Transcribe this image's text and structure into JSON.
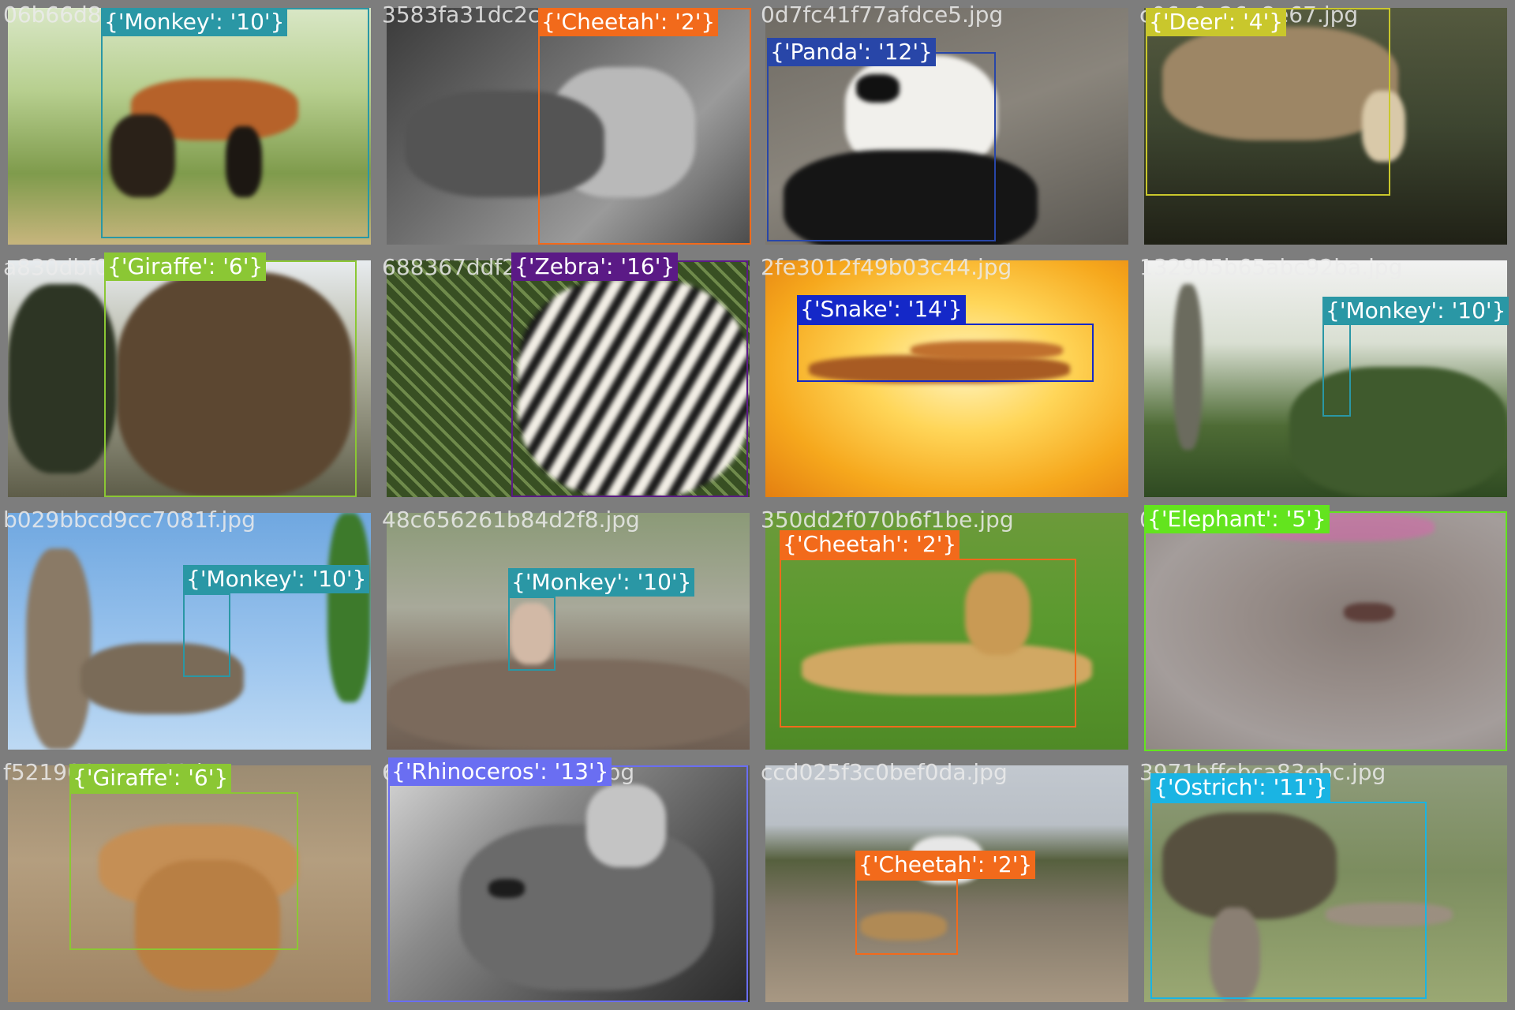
{
  "tiles": [
    {
      "filename": "06b66d8",
      "det": {
        "label": "{'Monkey': '10'}",
        "color": "#2a97a5"
      },
      "photo": {
        "bg": "linear-gradient(180deg,#d9e7c6 0%,#b7cf8f 35%,#7f9b4c 70%,#c7b57d 100%)",
        "blobs": [
          {
            "c": "#b6622a",
            "l": "34%",
            "t": "30%",
            "w": "46%",
            "h": "26%"
          },
          {
            "c": "#2a2118",
            "l": "28%",
            "t": "45%",
            "w": "18%",
            "h": "35%"
          },
          {
            "c": "#1c1712",
            "l": "60%",
            "t": "50%",
            "w": "10%",
            "h": "30%"
          }
        ]
      }
    },
    {
      "filename": "3583fa31dc2c",
      "det": {
        "label": "{'Cheetah': '2'}",
        "color": "#f26a1b"
      },
      "photo": {
        "bg": "linear-gradient(135deg,#3a3a3a 0%,#6d6d6d 40%,#9a9a9a 70%,#4c4c4c 100%)",
        "blobs": [
          {
            "c": "#b9b9b9",
            "l": "45%",
            "t": "25%",
            "w": "40%",
            "h": "55%"
          },
          {
            "c": "#545454",
            "l": "5%",
            "t": "35%",
            "w": "55%",
            "h": "45%"
          }
        ]
      }
    },
    {
      "filename": "0d7fc41f77afdce5.jpg",
      "det": {
        "label": "{'Panda': '12'}",
        "color": "#2846a8"
      },
      "photo": {
        "bg": "linear-gradient(160deg,#6e6a63 0%,#8a857c 50%,#5b5852 100%)",
        "blobs": [
          {
            "c": "#f1f0ec",
            "l": "22%",
            "t": "20%",
            "w": "42%",
            "h": "50%"
          },
          {
            "c": "#151515",
            "l": "5%",
            "t": "60%",
            "w": "70%",
            "h": "45%"
          },
          {
            "c": "#111111",
            "l": "25%",
            "t": "28%",
            "w": "12%",
            "h": "12%"
          }
        ]
      }
    },
    {
      "filename": "c06e9c26a8e67.jpg",
      "det": {
        "label": "{'Deer': '4'}",
        "color": "#c9c72c"
      },
      "photo": {
        "bg": "linear-gradient(180deg,#555a3f 0%,#3d4530 50%,#202116 100%)",
        "blobs": [
          {
            "c": "#9d8665",
            "l": "5%",
            "t": "8%",
            "w": "65%",
            "h": "48%"
          },
          {
            "c": "#d9c9a9",
            "l": "60%",
            "t": "35%",
            "w": "12%",
            "h": "30%"
          }
        ]
      }
    },
    {
      "filename": "a830dbf04385b821.jpg",
      "det": {
        "label": "{'Giraffe': '6'}",
        "color": "#8bc734"
      },
      "photo": {
        "bg": "linear-gradient(180deg,#e8ecef 0%,#b5b6a4 40%,#5e5d49 100%)",
        "blobs": [
          {
            "c": "#5c4731",
            "l": "30%",
            "t": "5%",
            "w": "65%",
            "h": "95%"
          },
          {
            "c": "#2d3524",
            "l": "0%",
            "t": "10%",
            "w": "30%",
            "h": "80%"
          }
        ]
      }
    },
    {
      "filename": "688367ddf28403d.jpg",
      "det": {
        "label": "{'Zebra': '16'}",
        "color": "#5b1a86"
      },
      "photo": {
        "bg": "repeating-linear-gradient(45deg,#384f23 0px,#384f23 10px,#6f8a4b 10px,#6f8a4b 14px)",
        "blobs": [
          {
            "c": "repeating-linear-gradient(120deg,#f3efe6 0px,#f3efe6 14px,#1a1a1a 14px,#1a1a1a 26px)",
            "l": "36%",
            "t": "8%",
            "w": "64%",
            "h": "92%"
          }
        ]
      }
    },
    {
      "filename": "2fe3012f49b03c44.jpg",
      "det": {
        "label": "{'Snake': '14'}",
        "color": "#1428c8"
      },
      "photo": {
        "bg": "radial-gradient(ellipse at 55% 45%,#fff4c0 0%,#ffd659 35%,#f6a81d 70%,#e47f10 100%)",
        "blobs": [
          {
            "c": "#a85b23",
            "l": "12%",
            "t": "40%",
            "w": "72%",
            "h": "12%"
          },
          {
            "c": "#c0702e",
            "l": "40%",
            "t": "34%",
            "w": "42%",
            "h": "8%"
          }
        ]
      }
    },
    {
      "filename": "132905b65abc92ba.jpg",
      "det": {
        "label": "{'Monkey': '10'}",
        "color": "#2a97a5"
      },
      "photo": {
        "bg": "linear-gradient(180deg,#f2f2f2 0%,#d9dfd2 35%,#4e6b35 70%,#2f4a22 100%)",
        "blobs": [
          {
            "c": "#6b6b5e",
            "l": "8%",
            "t": "10%",
            "w": "8%",
            "h": "70%"
          },
          {
            "c": "#3f5a2d",
            "l": "40%",
            "t": "45%",
            "w": "60%",
            "h": "55%"
          }
        ]
      }
    },
    {
      "filename": "b029bbcd9cc7081f.jpg",
      "det": {
        "label": "{'Monkey': '10'}",
        "color": "#2a97a5"
      },
      "photo": {
        "bg": "linear-gradient(180deg,#6fa7e0 0%,#9cc5ee 60%,#bdd9f3 100%)",
        "blobs": [
          {
            "c": "#8a7a66",
            "l": "5%",
            "t": "15%",
            "w": "18%",
            "h": "85%"
          },
          {
            "c": "#7a6b58",
            "l": "20%",
            "t": "55%",
            "w": "45%",
            "h": "30%"
          },
          {
            "c": "#3d7a2b",
            "l": "88%",
            "t": "0%",
            "w": "12%",
            "h": "80%"
          }
        ]
      }
    },
    {
      "filename": "48c656261b84d2f8.jpg",
      "det": {
        "label": "{'Monkey': '10'}",
        "color": "#2a97a5"
      },
      "photo": {
        "bg": "linear-gradient(180deg,#8b9a77 0%,#a8a99a 40%,#8c8173 62%,#6e5e52 100%)",
        "blobs": [
          {
            "c": "#7b6a5c",
            "l": "0%",
            "t": "62%",
            "w": "100%",
            "h": "38%"
          },
          {
            "c": "#d2b9a6",
            "l": "34%",
            "t": "38%",
            "w": "12%",
            "h": "26%"
          }
        ]
      }
    },
    {
      "filename": "350dd2f070b6f1be.jpg",
      "det": {
        "label": "{'Cheetah': '2'}",
        "color": "#f26a1b"
      },
      "photo": {
        "bg": "linear-gradient(180deg,#6c9a3a 0%,#5b9a2f 45%,#4f8a26 100%)",
        "blobs": [
          {
            "c": "#d1a863",
            "l": "10%",
            "t": "55%",
            "w": "80%",
            "h": "22%"
          },
          {
            "c": "#c99a54",
            "l": "55%",
            "t": "25%",
            "w": "18%",
            "h": "35%"
          }
        ]
      }
    },
    {
      "filename": "0d1db...1f61.jpg",
      "det": {
        "label": "{'Elephant': '5'}",
        "color": "#63e41e"
      },
      "photo": {
        "bg": "radial-gradient(ellipse at 60% 45%,#867b76 0%,#988e8a 40%,#a49d9b 70%,#8f8783 100%)",
        "blobs": [
          {
            "c": "#5d3f3a",
            "l": "55%",
            "t": "38%",
            "w": "14%",
            "h": "8%"
          },
          {
            "c": "rgba(230,90,180,0.45)",
            "l": "30%",
            "t": "0%",
            "w": "50%",
            "h": "12%"
          }
        ]
      }
    },
    {
      "filename": "f521906c4c4a82.jpg",
      "det": {
        "label": "{'Giraffe': '6'}",
        "color": "#8bc734"
      },
      "photo": {
        "bg": "linear-gradient(180deg,#9c8c72 0%,#b49e7f 40%,#a08563 100%)",
        "blobs": [
          {
            "c": "#c58f55",
            "l": "25%",
            "t": "25%",
            "w": "55%",
            "h": "35%"
          },
          {
            "c": "#b87f44",
            "l": "35%",
            "t": "40%",
            "w": "40%",
            "h": "55%"
          }
        ]
      }
    },
    {
      "filename": "683f62f92398ae57.jpg",
      "det": {
        "label": "{'Rhinoceros': '13'}",
        "color": "#6a6ef2"
      },
      "photo": {
        "bg": "linear-gradient(135deg,#d6d6d6 0%,#8a8a8a 35%,#505050 70%,#2a2a2a 100%)",
        "blobs": [
          {
            "c": "#6a6a6a",
            "l": "20%",
            "t": "25%",
            "w": "70%",
            "h": "70%"
          },
          {
            "c": "#c4c4c4",
            "l": "55%",
            "t": "8%",
            "w": "22%",
            "h": "35%"
          },
          {
            "c": "#1c1c1c",
            "l": "28%",
            "t": "48%",
            "w": "10%",
            "h": "8%"
          }
        ]
      }
    },
    {
      "filename": "ccd025f3c0bef0da.jpg",
      "det": {
        "label": "{'Cheetah': '2'}",
        "color": "#f26a1b"
      },
      "photo": {
        "bg": "linear-gradient(180deg,#c2c8cf 0%,#b9bfc6 25%,#56603e 40%,#7f7667 60%,#a89883 100%)",
        "blobs": [
          {
            "c": "#e7e7e7",
            "l": "40%",
            "t": "30%",
            "w": "20%",
            "h": "20%"
          },
          {
            "c": "#b08a55",
            "l": "26%",
            "t": "62%",
            "w": "24%",
            "h": "12%"
          }
        ]
      }
    },
    {
      "filename": "3971bffcbca83ebc.jpg",
      "det": {
        "label": "{'Ostrich': '11'}",
        "color": "#1ab4e3"
      },
      "photo": {
        "bg": "linear-gradient(180deg,#8e9b7a 0%,#7c8d5f 45%,#9aa873 100%)",
        "blobs": [
          {
            "c": "#57503f",
            "l": "5%",
            "t": "20%",
            "w": "48%",
            "h": "45%"
          },
          {
            "c": "#9b8f80",
            "l": "50%",
            "t": "58%",
            "w": "35%",
            "h": "10%"
          },
          {
            "c": "#8a7f73",
            "l": "18%",
            "t": "60%",
            "w": "14%",
            "h": "40%"
          }
        ]
      }
    }
  ]
}
